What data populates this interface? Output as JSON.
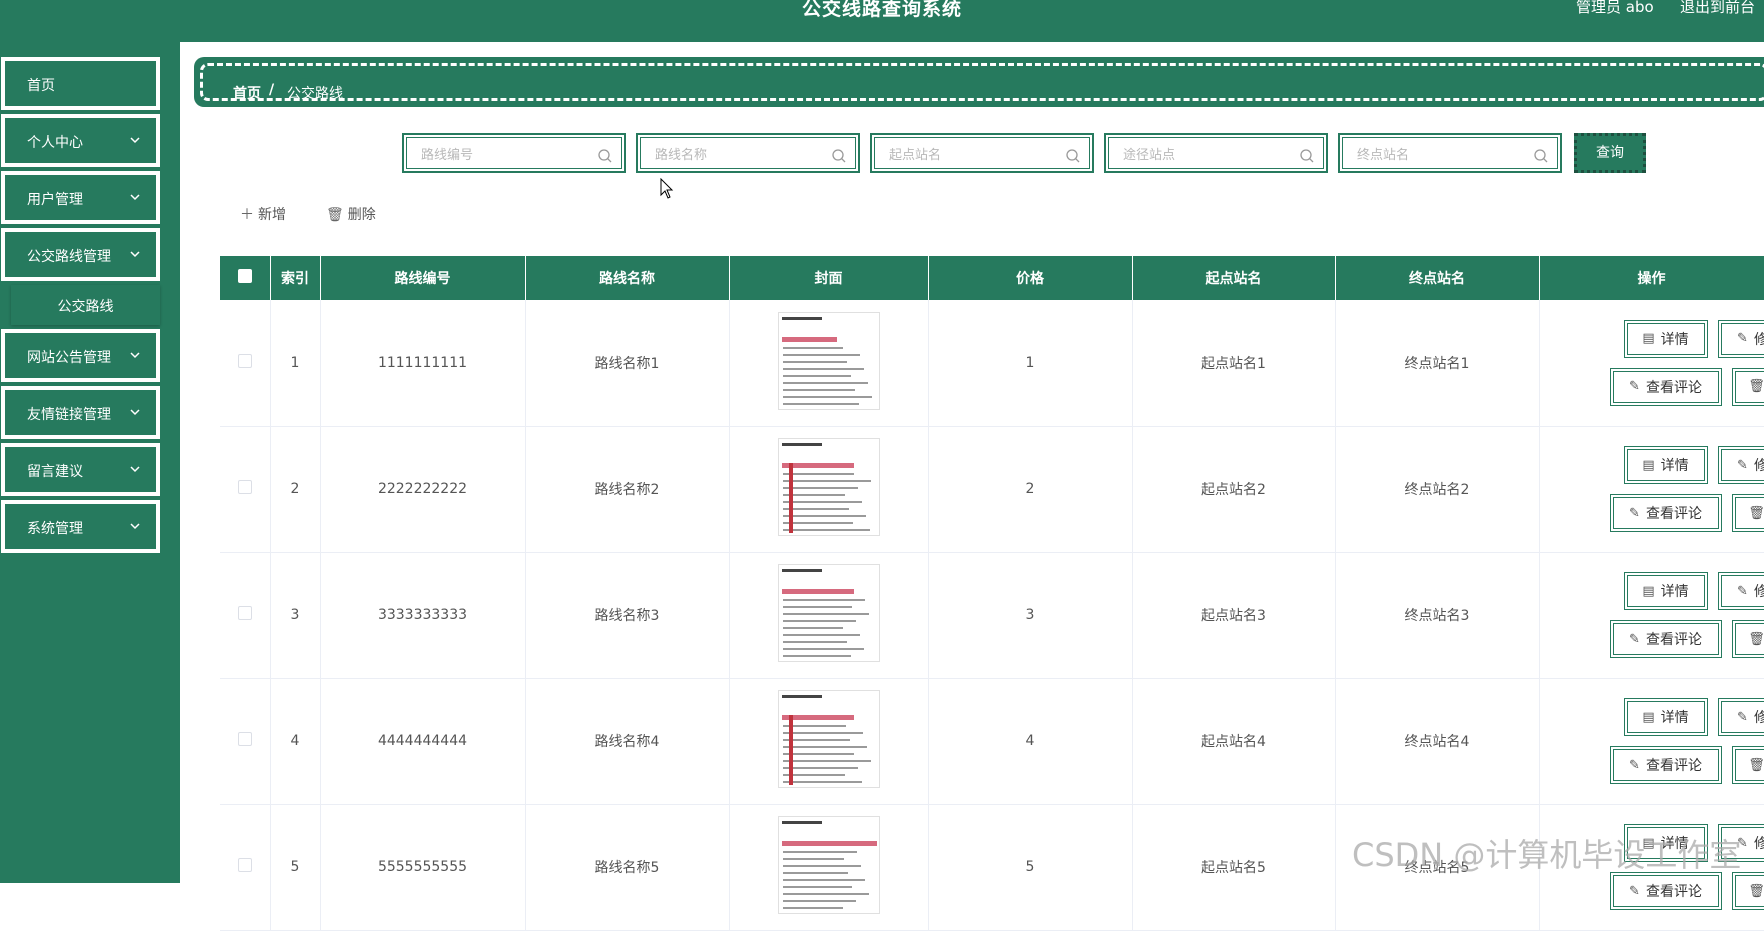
{
  "app": {
    "title": "公交线路查询系统",
    "user_label": "管理员 abo",
    "logout_label": "退出到前台"
  },
  "sidebar": {
    "items": [
      {
        "label": "首页",
        "has_chevron": false
      },
      {
        "label": "个人中心",
        "has_chevron": true
      },
      {
        "label": "用户管理",
        "has_chevron": true
      },
      {
        "label": "公交路线管理",
        "has_chevron": true
      },
      {
        "label": "网站公告管理",
        "has_chevron": true
      },
      {
        "label": "友情链接管理",
        "has_chevron": true
      },
      {
        "label": "留言建议",
        "has_chevron": true
      },
      {
        "label": "系统管理",
        "has_chevron": true
      }
    ],
    "submenu": {
      "label": "公交路线"
    }
  },
  "breadcrumb": {
    "home": "首页",
    "separator": "/",
    "current": "公交路线"
  },
  "search": {
    "fields": [
      {
        "placeholder": "路线编号"
      },
      {
        "placeholder": "路线名称"
      },
      {
        "placeholder": "起点站名"
      },
      {
        "placeholder": "途径站点"
      },
      {
        "placeholder": "终点站名"
      }
    ],
    "query_label": "查询"
  },
  "actions": {
    "add_label": "新增",
    "delete_label": "删除"
  },
  "table": {
    "headers": [
      "索引",
      "路线编号",
      "路线名称",
      "封面",
      "价格",
      "起点站名",
      "终点站名",
      "操作"
    ],
    "rows": [
      {
        "index": "1",
        "code": "1111111111",
        "name": "路线名称1",
        "price": "1",
        "start": "起点站名1",
        "end": "终点站名1"
      },
      {
        "index": "2",
        "code": "2222222222",
        "name": "路线名称2",
        "price": "2",
        "start": "起点站名2",
        "end": "终点站名2"
      },
      {
        "index": "3",
        "code": "3333333333",
        "name": "路线名称3",
        "price": "3",
        "start": "起点站名3",
        "end": "终点站名3"
      },
      {
        "index": "4",
        "code": "4444444444",
        "name": "路线名称4",
        "price": "4",
        "start": "起点站名4",
        "end": "终点站名4"
      },
      {
        "index": "5",
        "code": "5555555555",
        "name": "路线名称5",
        "price": "5",
        "start": "起点站名5",
        "end": "终点站名5"
      }
    ],
    "row_actions": {
      "detail": "详情",
      "edit": "修改",
      "comments": "查看评论",
      "delete": "删除"
    }
  },
  "watermark": "CSDN @计算机毕设工作室",
  "colors": {
    "primary": "#267a5e",
    "white": "#ffffff"
  }
}
